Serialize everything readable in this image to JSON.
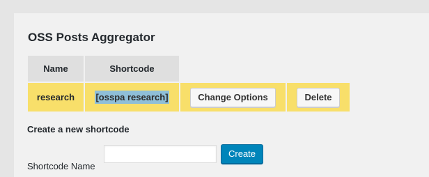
{
  "header": {
    "title": "OSS Posts Aggregator"
  },
  "table": {
    "columns": [
      "Name",
      "Shortcode"
    ],
    "rows": [
      {
        "name": "research",
        "shortcode": "[osspa research]",
        "change_label": "Change Options",
        "delete_label": "Delete"
      }
    ]
  },
  "create_form": {
    "heading": "Create a new shortcode",
    "field_label": "Shortcode Name",
    "field_value": "",
    "field_placeholder": "",
    "button_label": "Create"
  },
  "colors": {
    "row_highlight": "#f8df6a",
    "header_bg": "#dfdfdf",
    "selection": "#8fbfd8",
    "primary_button": "#0085ba"
  }
}
